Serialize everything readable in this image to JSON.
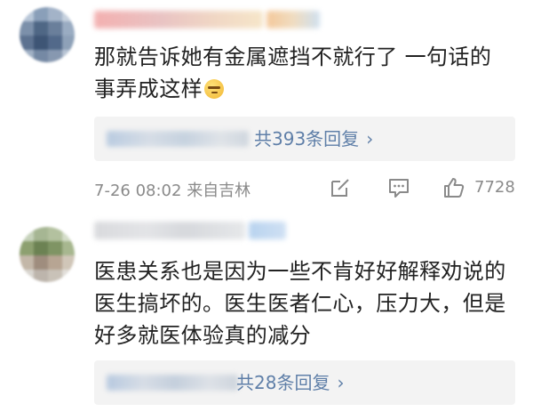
{
  "comments": [
    {
      "text_line1": "那就告诉她有金属遮挡不就行了 一句话的",
      "text_line2": "事弄成这样",
      "emoji": "smirk-emoji",
      "reply_count": "共393条回复",
      "reply_chevron": "›",
      "time": "7-26 08:02",
      "location": "来自吉林",
      "likes": "7728"
    },
    {
      "text_line1": "医患关系也是因为一些不肯好好解释劝说的",
      "text_line2": "医生搞坏的。医生医者仁心，压力大，但是",
      "text_line3": "好多就医体验真的减分",
      "reply_count": "共28条回复",
      "reply_chevron": "›"
    }
  ],
  "colors": {
    "reply_link": "#5f7fa8",
    "meta_gray": "#8a8a8a",
    "reply_bg": "#f3f3f3"
  },
  "icons": [
    "share-icon",
    "comment-icon",
    "like-icon"
  ]
}
